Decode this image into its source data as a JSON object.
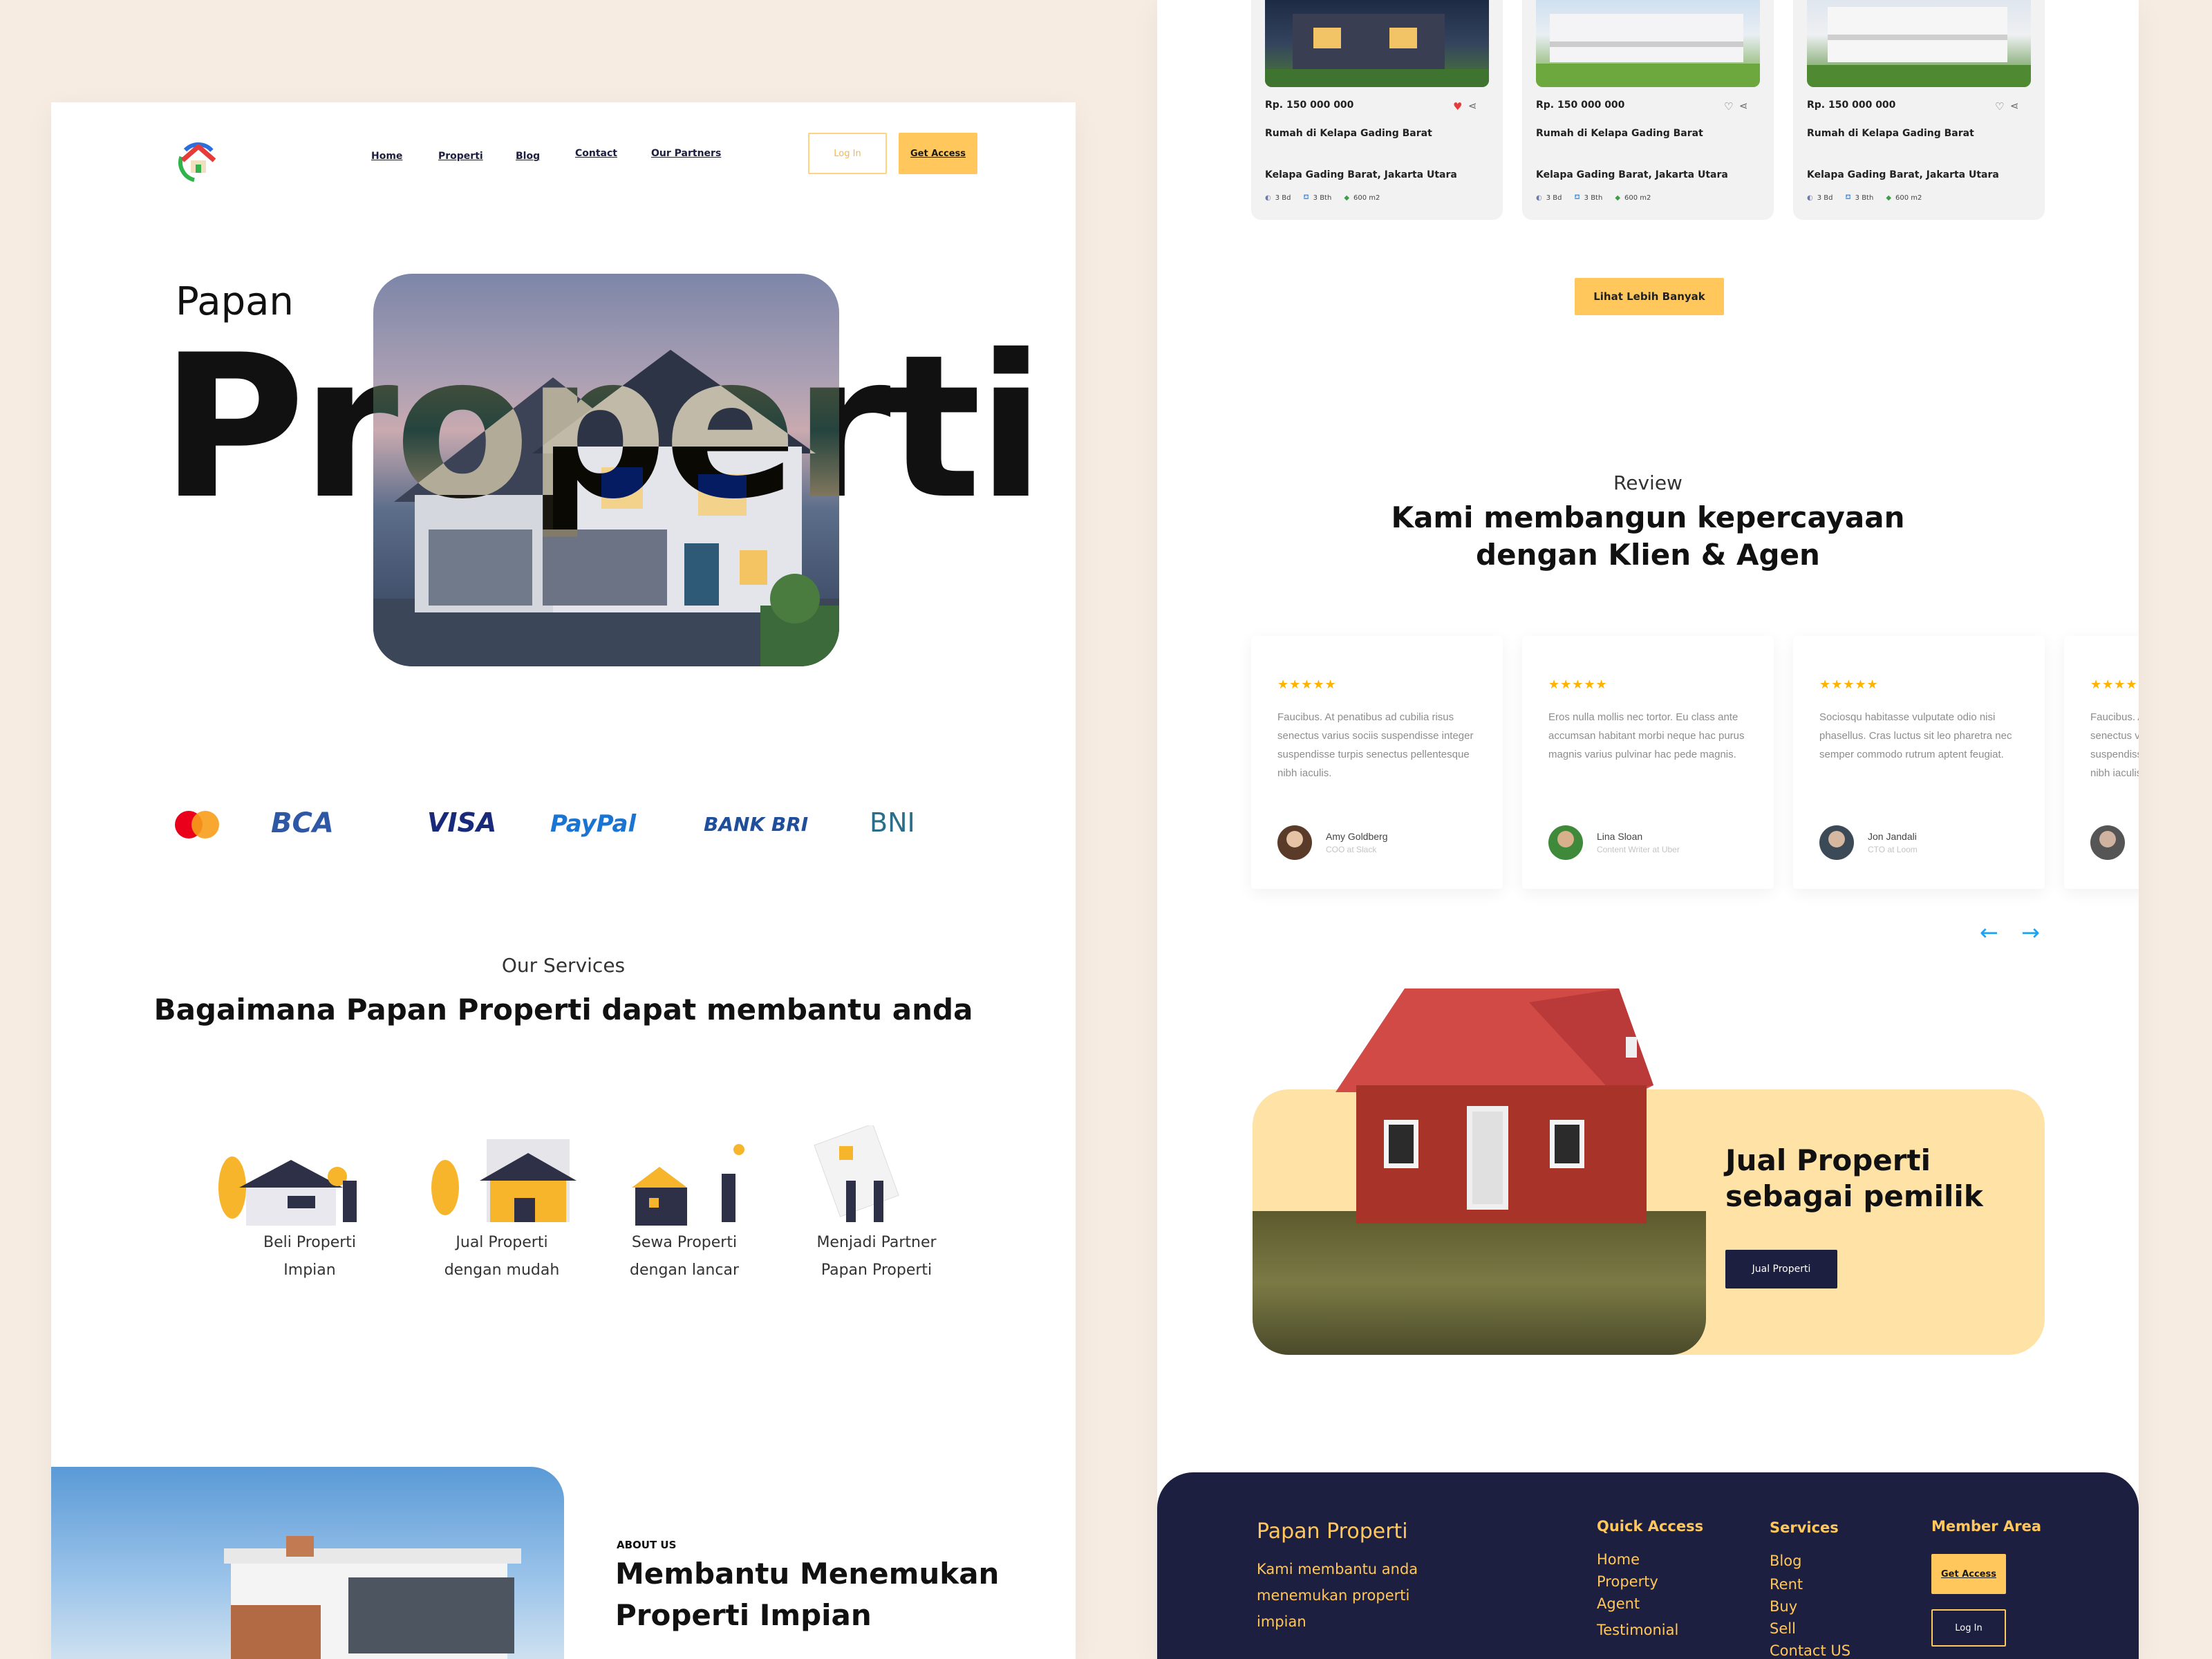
{
  "nav": {
    "items": [
      "Home",
      "Properti",
      "Blog",
      "Contact",
      "Our Partners"
    ],
    "login": "Log In",
    "get_access": "Get Access"
  },
  "hero": {
    "small": "Papan",
    "big": "Properti"
  },
  "payment_logos": [
    "mastercard",
    "BCA",
    "VISA",
    "PayPal",
    "BANK BRI",
    "BNI"
  ],
  "services": {
    "eyebrow": "Our Services",
    "title": "Bagaimana Papan Properti dapat membantu anda",
    "items": [
      {
        "line1": "Beli Properti",
        "line2": "Impian"
      },
      {
        "line1": "Jual Properti",
        "line2": "dengan mudah"
      },
      {
        "line1": "Sewa Properti",
        "line2": "dengan lancar"
      },
      {
        "line1": "Menjadi Partner",
        "line2": "Papan Properti"
      }
    ]
  },
  "about": {
    "eyebrow": "ABOUT US",
    "title_line1": "Membantu Menemukan",
    "title_line2": "Properti Impian"
  },
  "properties": [
    {
      "price": "Rp. 150 000 000",
      "title": "Rumah di Kelapa Gading Barat",
      "location": "Kelapa Gading Barat, Jakarta Utara",
      "bed": "3 Bd",
      "bath": "3 Bth",
      "area": "600 m2",
      "liked": true
    },
    {
      "price": "Rp. 150 000 000",
      "title": "Rumah di Kelapa Gading Barat",
      "location": "Kelapa Gading Barat, Jakarta Utara",
      "bed": "3 Bd",
      "bath": "3 Bth",
      "area": "600 m2",
      "liked": false
    },
    {
      "price": "Rp. 150 000 000",
      "title": "Rumah di Kelapa Gading Barat",
      "location": "Kelapa Gading Barat, Jakarta Utara",
      "bed": "3 Bd",
      "bath": "3 Bth",
      "area": "600 m2",
      "liked": false
    }
  ],
  "more_button": "Lihat Lebih Banyak",
  "review": {
    "eyebrow": "Review",
    "title_line1": "Kami membangun kepercayaan",
    "title_line2": "dengan Klien & Agen",
    "stars": "★★★★★",
    "items": [
      {
        "text": "Faucibus. At penatibus ad cubilia risus senectus varius sociis suspendisse integer suspendisse turpis senectus pellentesque nibh iaculis.",
        "name": "Amy Goldberg",
        "role": "COO at Slack"
      },
      {
        "text": "Eros nulla mollis nec tortor. Eu class ante accumsan habitant morbi neque hac purus magnis varius pulvinar hac pede magnis.",
        "name": "Lina Sloan",
        "role": "Content Writer at Uber"
      },
      {
        "text": "Sociosqu habitasse vulputate odio nisi phasellus. Cras luctus sit leo pharetra nec semper commodo rutrum aptent feugiat.",
        "name": "Jon Jandali",
        "role": "CTO at Loom"
      },
      {
        "text": "Faucibus. At penatibus ad cubilia risus senectus varius sociis suspendisse integer suspendisse turpis senectus pellentesque nibh iaculis.",
        "name": "",
        "role": ""
      }
    ]
  },
  "sell": {
    "title_line1": "Jual Properti",
    "title_line2": "sebagai pemilik",
    "button": "Jual Properti"
  },
  "footer": {
    "brand": "Papan Properti",
    "tagline": [
      "Kami membantu anda",
      "menemukan properti",
      "impian"
    ],
    "quick_access": {
      "heading": "Quick Access",
      "links": [
        "Home",
        "Property",
        "Agent",
        "Testimonial"
      ]
    },
    "services": {
      "heading": "Services",
      "links": [
        "Blog",
        "Rent",
        "Buy",
        "Sell",
        "Contact US"
      ]
    },
    "member": {
      "heading": "Member Area",
      "get_access": "Get Access",
      "login": "Log In"
    }
  },
  "colors": {
    "accent": "#ffc75c",
    "navy": "#1c1f3f",
    "background": "#f6ece2",
    "sell_bg": "#ffe2a6",
    "link_blue": "#1da1f2"
  }
}
